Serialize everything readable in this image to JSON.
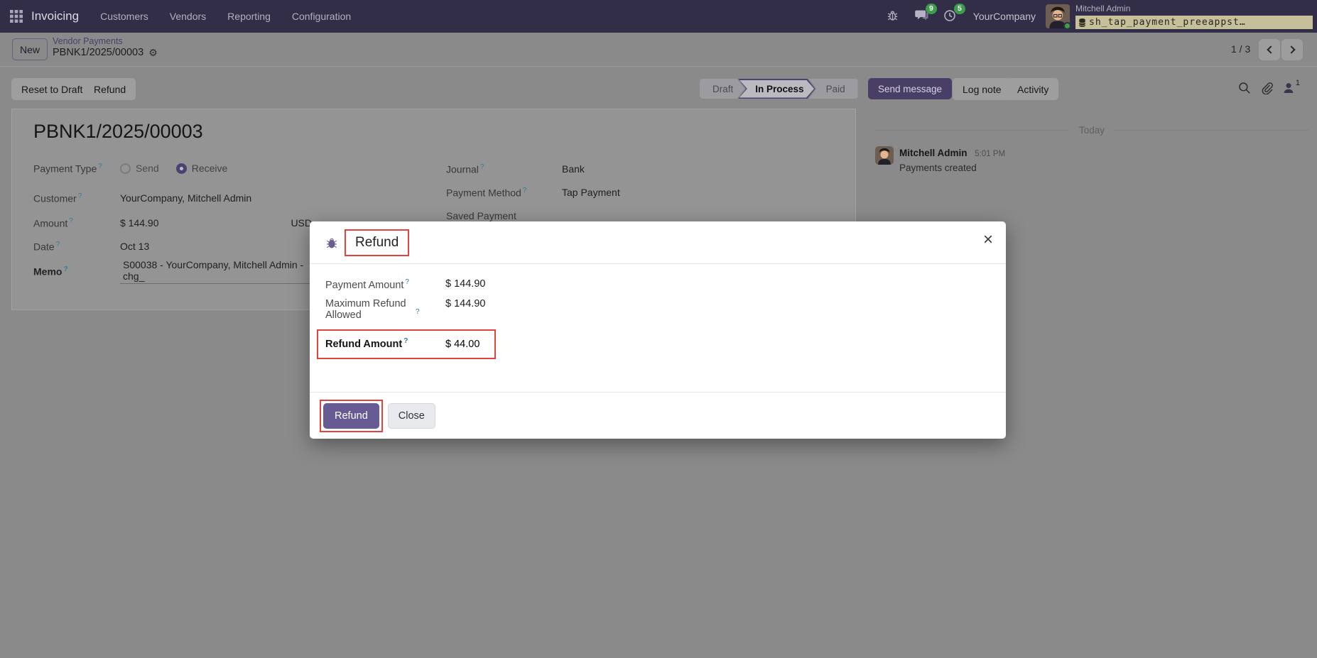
{
  "ui": {
    "help_marker": "?",
    "close_glyph": "×",
    "gear_glyph": "⚙"
  },
  "colors": {
    "navbar_bg": "#322e47",
    "primary": "#685a92",
    "annotation_red": "#e5413f",
    "badge_green": "#3c9e4d"
  },
  "navbar": {
    "app_name": "Invoicing",
    "menus": [
      "Customers",
      "Vendors",
      "Reporting",
      "Configuration"
    ],
    "message_badge": "9",
    "activity_badge": "5",
    "company": "YourCompany",
    "user_name": "Mitchell Admin",
    "database": "sh_tap_payment_preeappst…"
  },
  "control_panel": {
    "new_button": "New",
    "breadcrumb_parent": "Vendor Payments",
    "breadcrumb_current": "PBNK1/2025/00003",
    "pager": "1 / 3",
    "reset_to_draft_button": "Reset to Draft",
    "refund_button": "Refund"
  },
  "statusbar": {
    "steps": [
      {
        "label": "Draft",
        "active": false
      },
      {
        "label": "In Process",
        "active": true
      },
      {
        "label": "Paid",
        "active": false
      }
    ]
  },
  "chatter": {
    "send_message_button": "Send message",
    "log_note_button": "Log note",
    "activity_button": "Activity",
    "followers_count": "1",
    "date_divider": "Today",
    "message": {
      "author": "Mitchell Admin",
      "time": "5:01 PM",
      "body": "Payments created"
    }
  },
  "form": {
    "title": "PBNK1/2025/00003",
    "payment_type": {
      "label": "Payment Type",
      "options": [
        "Send",
        "Receive"
      ],
      "selected": "Receive"
    },
    "customer": {
      "label": "Customer",
      "value": "YourCompany, Mitchell Admin"
    },
    "amount": {
      "label": "Amount",
      "value": "$ 144.90",
      "currency": "USD"
    },
    "date": {
      "label": "Date",
      "value": "Oct 13"
    },
    "memo": {
      "label": "Memo",
      "value": "S00038 - YourCompany, Mitchell Admin - chg_"
    },
    "journal": {
      "label": "Journal",
      "value": "Bank"
    },
    "payment_method": {
      "label": "Payment Method",
      "value": "Tap Payment"
    },
    "saved_payment": {
      "label": "Saved Payment",
      "value": ""
    }
  },
  "modal": {
    "title": "Refund",
    "rows": [
      {
        "label": "Payment Amount",
        "value": "$ 144.90"
      },
      {
        "label": "Maximum Refund Allowed",
        "value": "$ 144.90"
      },
      {
        "label": "Refund Amount",
        "value": "$ 44.00"
      }
    ],
    "refund_button": "Refund",
    "close_button": "Close"
  }
}
